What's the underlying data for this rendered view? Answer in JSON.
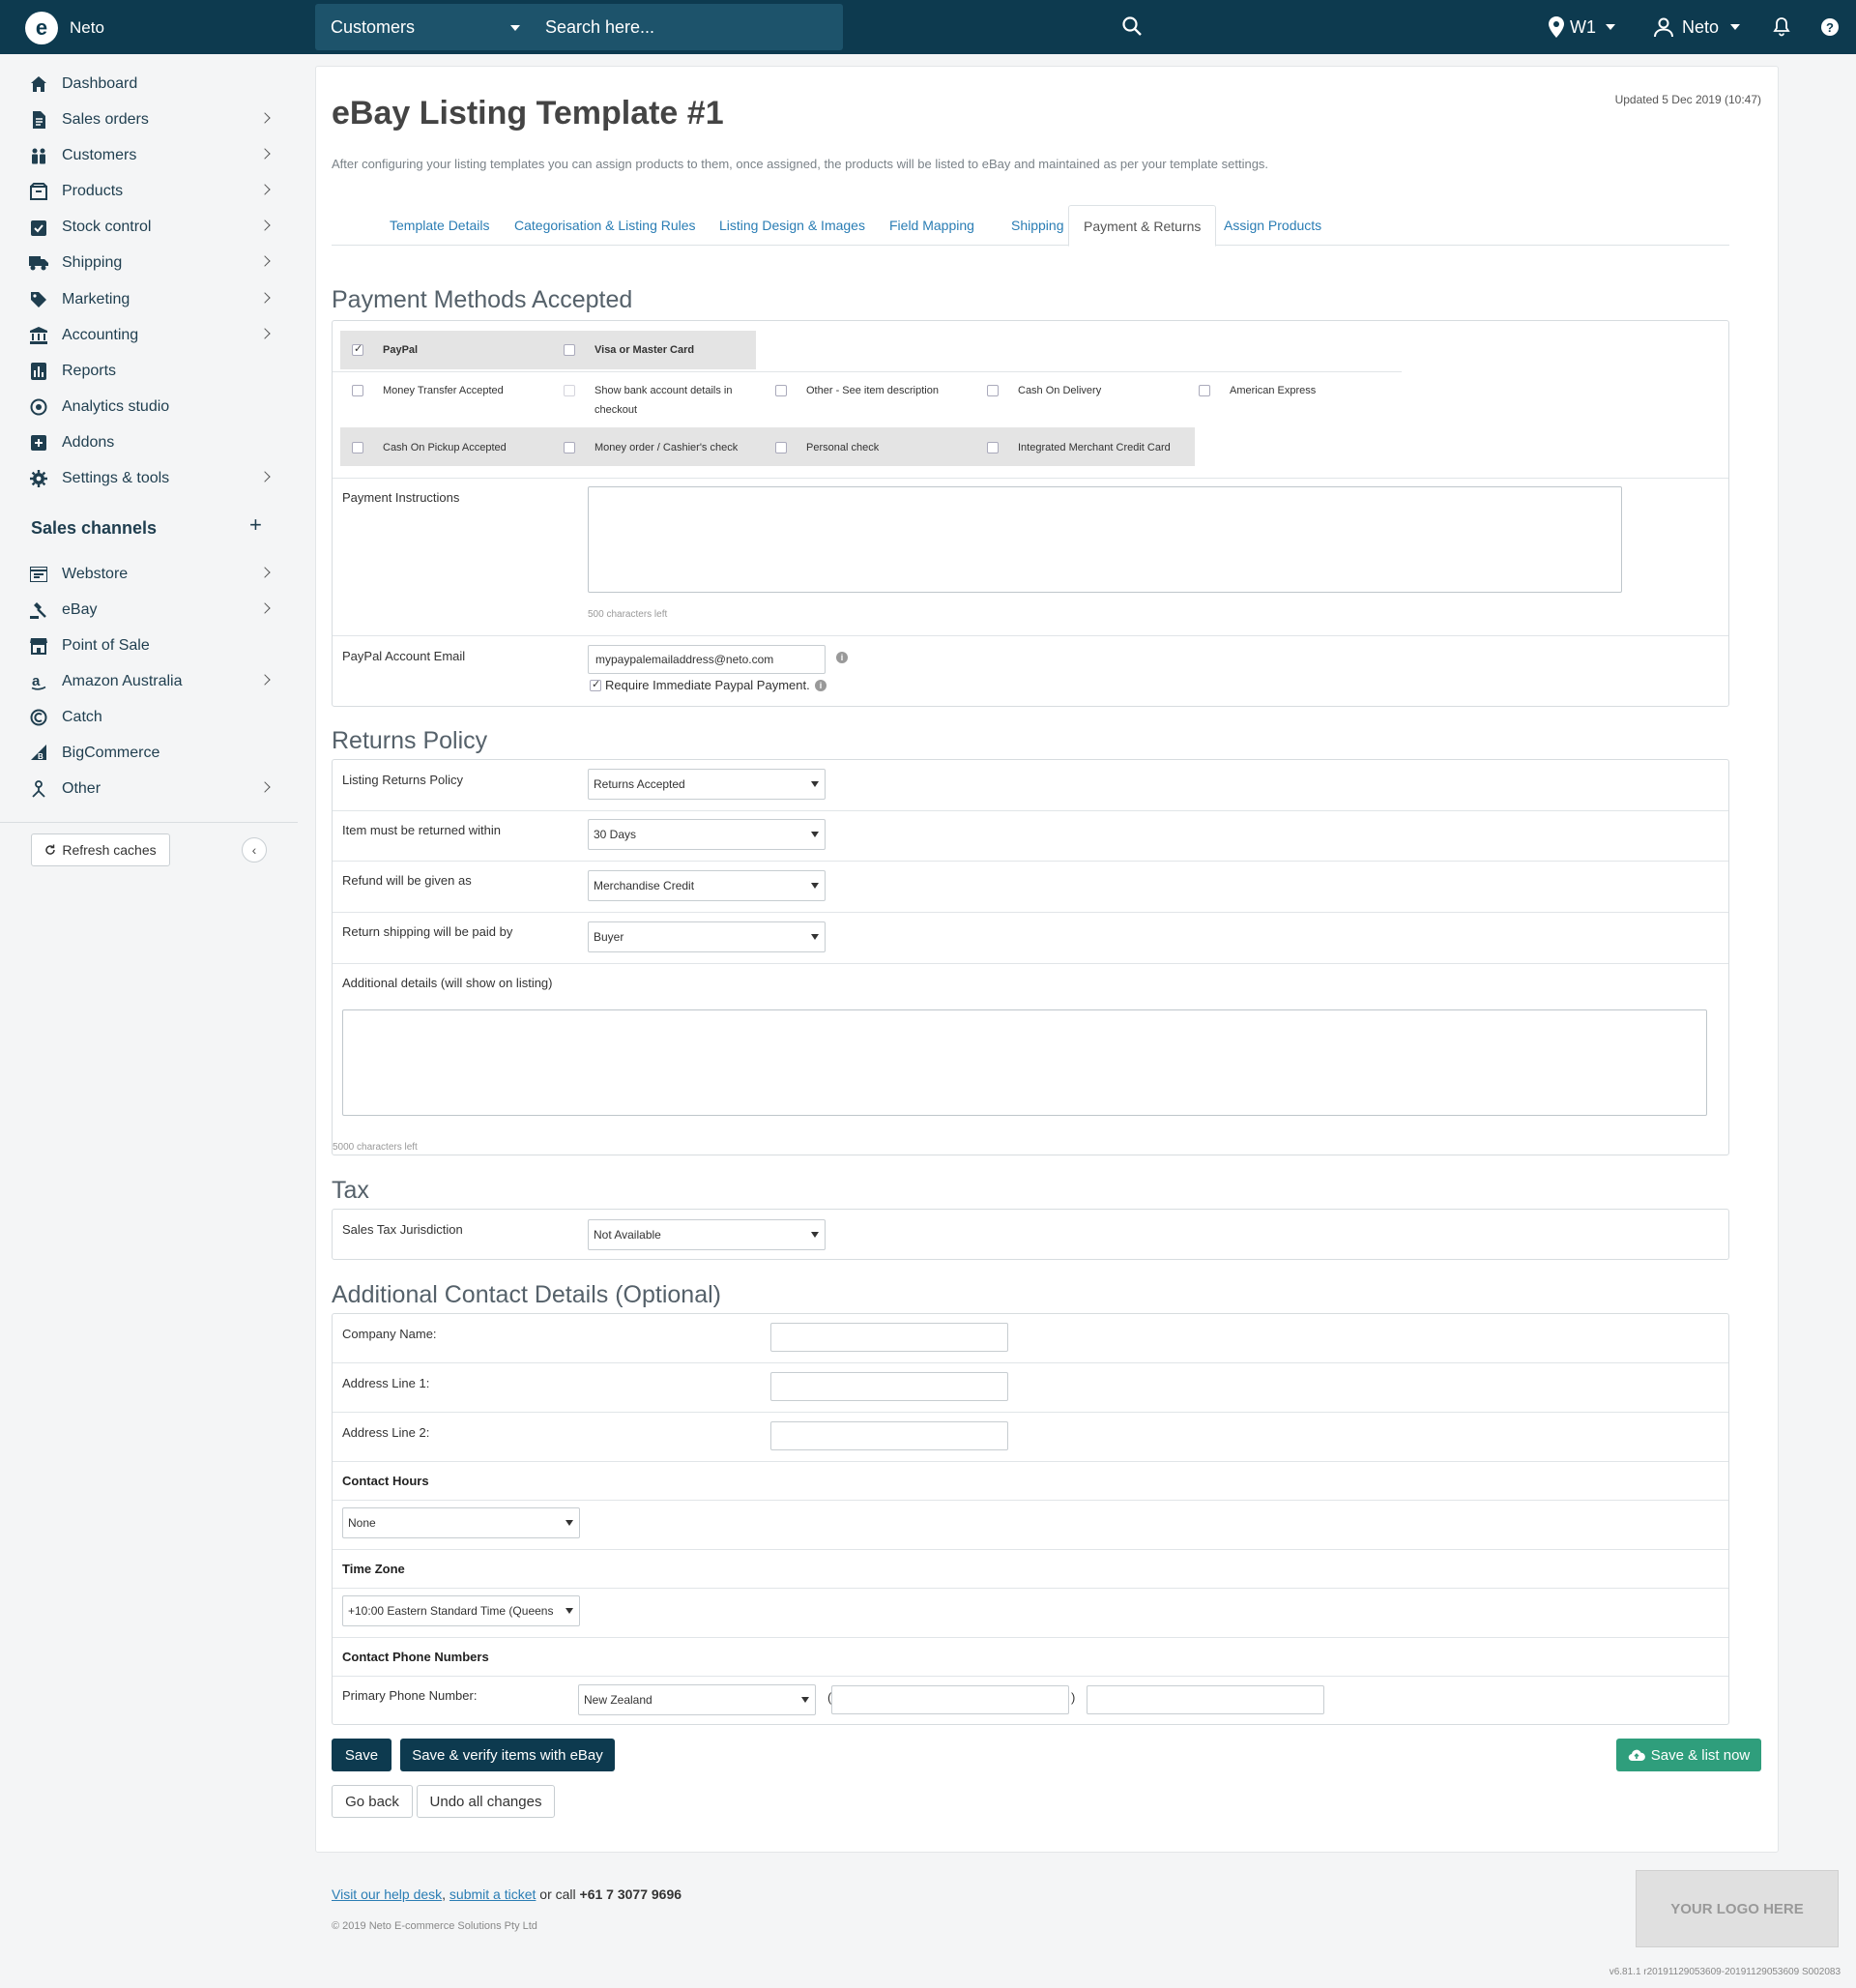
{
  "topbar": {
    "brand": "Neto",
    "search_scope": "Customers",
    "search_placeholder": "Search here...",
    "location": "W1",
    "user": "Neto"
  },
  "sidebar": {
    "items": [
      {
        "label": "Dashboard",
        "icon": "home-icon",
        "chevron": false
      },
      {
        "label": "Sales orders",
        "icon": "file-icon",
        "chevron": true
      },
      {
        "label": "Customers",
        "icon": "people-icon",
        "chevron": true
      },
      {
        "label": "Products",
        "icon": "box-icon",
        "chevron": true
      },
      {
        "label": "Stock control",
        "icon": "clipboard-check-icon",
        "chevron": true
      },
      {
        "label": "Shipping",
        "icon": "truck-icon",
        "chevron": true
      },
      {
        "label": "Marketing",
        "icon": "tag-icon",
        "chevron": true
      },
      {
        "label": "Accounting",
        "icon": "bank-icon",
        "chevron": true
      },
      {
        "label": "Reports",
        "icon": "bar-chart-icon",
        "chevron": false
      },
      {
        "label": "Analytics studio",
        "icon": "analytics-icon",
        "chevron": false
      },
      {
        "label": "Addons",
        "icon": "plus-square-icon",
        "chevron": false
      },
      {
        "label": "Settings & tools",
        "icon": "gear-icon",
        "chevron": true
      }
    ],
    "sales_channels_title": "Sales channels",
    "channels": [
      {
        "label": "Webstore",
        "icon": "webstore-icon",
        "chevron": true
      },
      {
        "label": "eBay",
        "icon": "gavel-icon",
        "chevron": true
      },
      {
        "label": "Point of Sale",
        "icon": "store-icon",
        "chevron": false
      },
      {
        "label": "Amazon Australia",
        "icon": "amazon-icon",
        "chevron": true
      },
      {
        "label": "Catch",
        "icon": "catch-icon",
        "chevron": false
      },
      {
        "label": "BigCommerce",
        "icon": "bigcommerce-icon",
        "chevron": false
      },
      {
        "label": "Other",
        "icon": "network-icon",
        "chevron": true
      }
    ],
    "refresh_label": "Refresh caches"
  },
  "page": {
    "title": "eBay Listing Template #1",
    "updated": "Updated 5 Dec 2019 (10:47)",
    "intro": "After configuring your listing templates you can assign products to them, once assigned, the products will be listed to eBay and maintained as per your template settings."
  },
  "tabs": [
    {
      "label": "Template Details",
      "active": false
    },
    {
      "label": "Categorisation & Listing Rules",
      "active": false
    },
    {
      "label": "Listing Design & Images",
      "active": false
    },
    {
      "label": "Field Mapping",
      "active": false
    },
    {
      "label": "Shipping",
      "active": false
    },
    {
      "label": "Payment & Returns",
      "active": true
    },
    {
      "label": "Assign Products",
      "active": false
    }
  ],
  "payment": {
    "section_title": "Payment Methods Accepted",
    "methods": [
      {
        "label": "PayPal",
        "checked": true,
        "bold": true
      },
      {
        "label": "Visa or Master Card",
        "checked": false,
        "bold": true
      },
      {
        "label": "Money Transfer Accepted",
        "checked": false
      },
      {
        "label": "Show bank account details in checkout",
        "checked": false
      },
      {
        "label": "Other - See item description",
        "checked": false
      },
      {
        "label": "Cash On Delivery",
        "checked": false
      },
      {
        "label": "American Express",
        "checked": false
      },
      {
        "label": "Cash On Pickup Accepted",
        "checked": false
      },
      {
        "label": "Money order / Cashier's check",
        "checked": false
      },
      {
        "label": "Personal check",
        "checked": false
      },
      {
        "label": "Integrated Merchant Credit Card",
        "checked": false
      }
    ],
    "instructions_label": "Payment Instructions",
    "instructions_chars": "500 characters left",
    "paypal_email_label": "PayPal Account Email",
    "paypal_email_value": "mypaypalemailaddress@neto.com",
    "require_immediate_label": "Require Immediate Paypal Payment.",
    "require_immediate_checked": true
  },
  "returns": {
    "section_title": "Returns Policy",
    "rows": [
      {
        "label": "Listing Returns Policy",
        "value": "Returns Accepted"
      },
      {
        "label": "Item must be returned within",
        "value": "30 Days"
      },
      {
        "label": "Refund will be given as",
        "value": "Merchandise Credit"
      },
      {
        "label": "Return shipping will be paid by",
        "value": "Buyer"
      }
    ],
    "additional_label": "Additional details (will show on listing)",
    "additional_chars": "5000 characters left"
  },
  "tax": {
    "section_title": "Tax",
    "label": "Sales Tax Jurisdiction",
    "value": "Not Available"
  },
  "contact": {
    "section_title": "Additional Contact Details (Optional)",
    "company_label": "Company Name:",
    "address1_label": "Address Line 1:",
    "address2_label": "Address Line 2:",
    "hours_title": "Contact Hours",
    "hours_value": "None",
    "tz_title": "Time Zone",
    "tz_value": "+10:00 Eastern Standard Time (Queens",
    "phones_title": "Contact Phone Numbers",
    "primary_label": "Primary Phone Number:",
    "country_value": "New Zealand",
    "paren_open": "(",
    "paren_close": ")"
  },
  "actions": {
    "save": "Save",
    "save_verify": "Save & verify items with eBay",
    "save_list": "Save & list now",
    "go_back": "Go back",
    "undo": "Undo all changes"
  },
  "footer": {
    "help_desk": "Visit our help desk",
    "comma": ",",
    "submit_ticket": "submit a ticket",
    "or_call": " or call ",
    "phone": "+61 7 3077 9696",
    "copyright": "© 2019 Neto E-commerce Solutions Pty Ltd",
    "logo_placeholder": "YOUR LOGO HERE",
    "version": "v6.81.1 r20191129053609-20191129053609 S002083"
  }
}
